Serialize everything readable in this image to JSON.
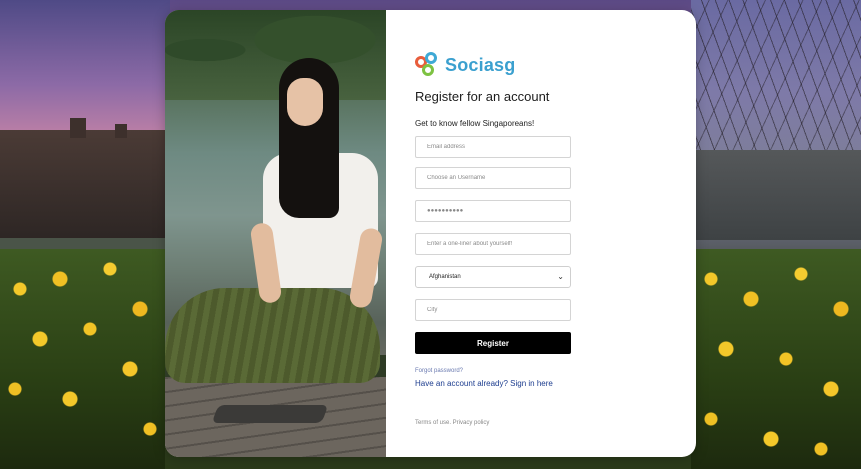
{
  "brand": {
    "name": "Sociasg",
    "accent": "#3ba0cf",
    "logo_colors": [
      "#e85d3c",
      "#3fa9d5",
      "#7dc242"
    ]
  },
  "form": {
    "title": "Register for an account",
    "subtitle": "Get to know fellow Singaporeans!",
    "email_placeholder": "Email address",
    "username_placeholder": "Choose an Username",
    "password_value": "●●●●●●●●●●",
    "bio_placeholder": "Enter a one-liner about yourself!",
    "country_selected": "Afghanistan",
    "city_placeholder": "City",
    "register_label": "Register",
    "forgot_label": "Forgot password?",
    "signin_label": "Have an account already? Sign in here",
    "terms_label": "Terms of use. Privacy policy"
  },
  "icons": {
    "select_chevron": "chevron-down-icon"
  }
}
